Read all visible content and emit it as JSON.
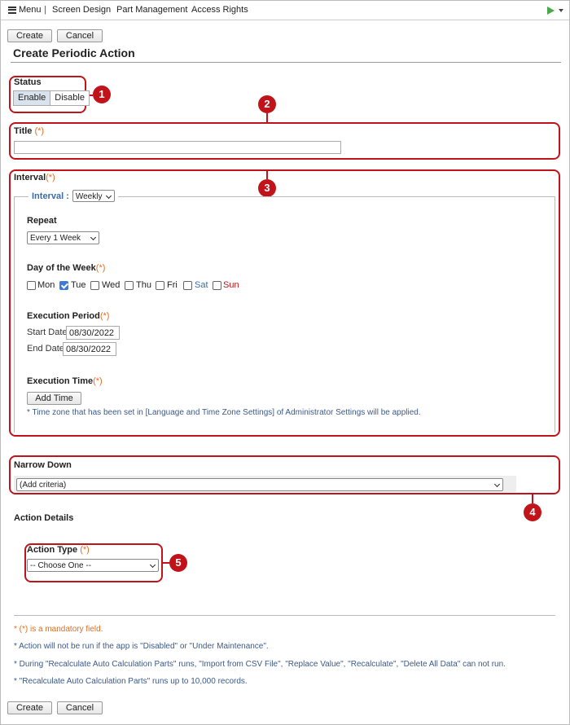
{
  "nav": {
    "menu_label": "Menu",
    "separator": "|",
    "links": [
      "Screen Design",
      "Part Management",
      "Access Rights"
    ]
  },
  "toolbar": {
    "create_label": "Create",
    "cancel_label": "Cancel"
  },
  "page_title": "Create Periodic Action",
  "status": {
    "label": "Status",
    "options": [
      "Enable",
      "Disable"
    ],
    "selected": "Enable"
  },
  "title_field": {
    "label": "Title",
    "required": "(*)",
    "value": ""
  },
  "interval": {
    "label": "Interval",
    "required": "(*)",
    "legend_label": "Interval :",
    "legend_value": "Weekly",
    "repeat_label": "Repeat",
    "repeat_value": "Every 1 Week",
    "dow_label": "Day of the Week",
    "dow_required": "(*)",
    "days": [
      {
        "label": "Mon",
        "checked": false
      },
      {
        "label": "Tue",
        "checked": true
      },
      {
        "label": "Wed",
        "checked": false
      },
      {
        "label": "Thu",
        "checked": false
      },
      {
        "label": "Fri",
        "checked": false
      },
      {
        "label": "Sat",
        "checked": false
      },
      {
        "label": "Sun",
        "checked": false
      }
    ],
    "period_label": "Execution Period",
    "period_required": "(*)",
    "start_label": "Start Date",
    "start_value": "08/30/2022",
    "end_label": "End Date",
    "end_value": "08/30/2022",
    "time_label": "Execution Time",
    "time_required": "(*)",
    "add_time_label": "Add Time",
    "timezone_note": "* Time zone that has been set in [Language and Time Zone Settings] of Administrator Settings will be applied."
  },
  "narrow_down": {
    "label": "Narrow Down",
    "value": "(Add criteria)"
  },
  "action_details": {
    "label": "Action Details",
    "type_label": "Action Type",
    "type_required": "(*)",
    "type_value": "-- Choose One --"
  },
  "notes": [
    "* (*) is a mandatory field.",
    "* Action will not be run if the app is \"Disabled\" or \"Under Maintenance\".",
    "* During \"Recalculate Auto Calculation Parts\" runs, \"Import from CSV File\", \"Replace Value\", \"Recalculate\", \"Delete All Data\" can not run.",
    "* \"Recalculate Auto Calculation Parts\" runs up to 10,000 records."
  ],
  "callouts": [
    "1",
    "2",
    "3",
    "4",
    "5"
  ],
  "colors": {
    "callout": "#c0131a",
    "required": "#e36d1e",
    "note": "#3c5a8a",
    "saturday": "#3a6ca8",
    "sunday": "#c0131a",
    "play": "#49a84a"
  }
}
